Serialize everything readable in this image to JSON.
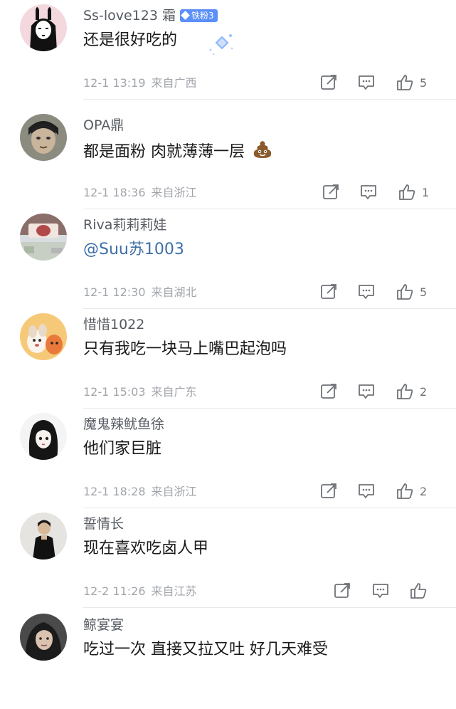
{
  "comments": [
    {
      "username": "Ss-love123 霜",
      "badge": "铁粉3",
      "text": "还是很好吃的",
      "time": "12-1 13:19",
      "location": "来自广西",
      "likes": "5"
    },
    {
      "username": "OPA鼎",
      "text": "都是面粉 肉就薄薄一层",
      "emoji": "poop-emoji",
      "time": "12-1 18:36",
      "location": "来自浙江",
      "likes": "1"
    },
    {
      "username": "Riva莉莉莉娃",
      "text": "@Suu苏1003",
      "time": "12-1 12:30",
      "location": "来自湖北",
      "likes": "5"
    },
    {
      "username": "惜惜1022",
      "text": "只有我吃一块马上嘴巴起泡吗",
      "time": "12-1 15:03",
      "location": "来自广东",
      "likes": "2"
    },
    {
      "username": "魔鬼辣鱿鱼徐",
      "text": "他们家巨脏",
      "time": "12-1 18:28",
      "location": "来自浙江",
      "likes": "2"
    },
    {
      "username": "誓情长",
      "text": "现在喜欢吃卤人甲",
      "time": "12-2 11:26",
      "location": "来自江苏",
      "likes": ""
    },
    {
      "username": "鲸宴宴",
      "text": "吃过一次 直接又拉又吐 好几天难受"
    }
  ],
  "colors": {
    "mention": "#3d6ea8",
    "badge": "#5b8ff9",
    "meta": "#a2a6ab"
  },
  "icons": [
    "share-icon",
    "comment-icon",
    "like-icon"
  ]
}
